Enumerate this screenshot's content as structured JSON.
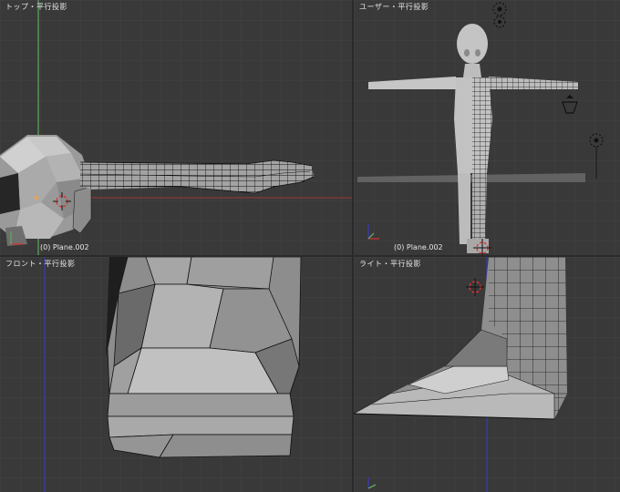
{
  "viewports": {
    "top": {
      "label": "トップ・平行投影",
      "object": "(0) Plane.002"
    },
    "user": {
      "label": "ユーザー・平行投影",
      "object": "(0) Plane.002"
    },
    "front": {
      "label": "フロント・平行投影"
    },
    "right": {
      "label": "ライト・平行投影"
    }
  },
  "colors": {
    "background": "#393939",
    "grid": "#434343",
    "x_axis": "#8e3535",
    "y_axis": "#5fa85f",
    "z_axis": "#3b3bb0",
    "mesh_light": "#b9b9b9",
    "mesh_mid": "#8d8d8d",
    "mesh_dark": "#5a5a5a",
    "wire": "#111111"
  },
  "icons": [
    "3d-cursor-icon",
    "lamp-icon",
    "camera-icon",
    "axis-gizmo-icon"
  ]
}
